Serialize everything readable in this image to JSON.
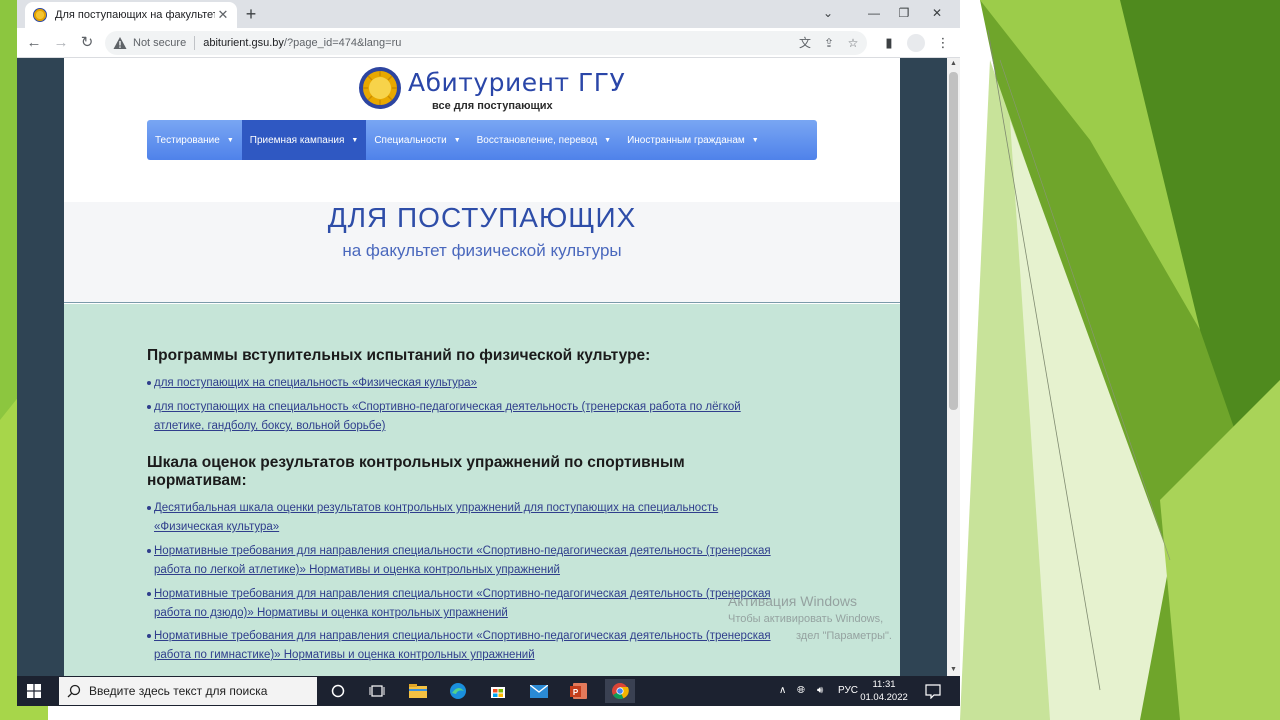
{
  "browser": {
    "tab_title": "Для поступающих на факультет",
    "not_secure": "Not secure",
    "url_host": "abiturient.gsu.by",
    "url_rest": "/?page_id=474&lang=ru"
  },
  "site": {
    "logo_title": "Абитуриент ГГУ",
    "logo_subtitle": "все для поступающих",
    "menu": [
      {
        "label": "Тестирование"
      },
      {
        "label": "Приемная кампания"
      },
      {
        "label": "Специальности"
      },
      {
        "label": "Восстановление, перевод"
      },
      {
        "label": "Иностранным гражданам"
      }
    ],
    "hero_title": "ДЛЯ ПОСТУПАЮЩИХ",
    "hero_subtitle": "на факультет физической культуры"
  },
  "content": {
    "section1_heading": "Программы вступительных испытаний по физической культуре:",
    "section1_links": [
      {
        "line1": "для поступающих на специальность «Физическая культура»",
        "line2": ""
      },
      {
        "line1": "для поступающих на специальность «Спортивно-педагогическая деятельность (тренерская работа по лёгкой",
        "line2": "атлетике, гандболу, боксу, вольной борьбе)"
      }
    ],
    "section2_heading_line1": "Шкала оценок результатов контрольных упражнений по спортивным",
    "section2_heading_line2": "нормативам:",
    "section2_links": [
      {
        "line1": "Десятибальная шкала оценки результатов контрольных упражнений для поступающих на специальность",
        "line2": "«Физическая культура»"
      },
      {
        "line1": "Нормативные требования для направления специальности «Спортивно-педагогическая деятельность (тренерская",
        "line2": "работа по легкой атлетике)» Нормативы и оценка контрольных упражнений"
      },
      {
        "line1": "Нормативные требования для направления специальности «Спортивно-педагогическая деятельность (тренерская",
        "line2": "работа по дзюдо)» Нормативы и оценка контрольных упражнений"
      },
      {
        "line1": "Нормативные требования для направления специальности «Спортивно-педагогическая деятельность (тренерская",
        "line2": "работа по гимнастике)» Нормативы и оценка контрольных упражнений"
      }
    ]
  },
  "watermark": {
    "line1": "Активация Windows",
    "line2": "Чтобы активировать Windows,",
    "line3": "здел \"Параметры\"."
  },
  "taskbar": {
    "search_placeholder": "Введите здесь текст для поиска",
    "lang": "РУС",
    "time": "11:31",
    "date": "01.04.2022"
  },
  "colors": {
    "menu_gradient_top": "#79a6f3",
    "menu_gradient_bottom": "#4f82ea",
    "menu_active": "#2f58c2",
    "content_bg": "#c6e5d8",
    "link": "#2f3e8c",
    "hero_title": "#2e4da8",
    "slide_green": "#8cc63f"
  }
}
